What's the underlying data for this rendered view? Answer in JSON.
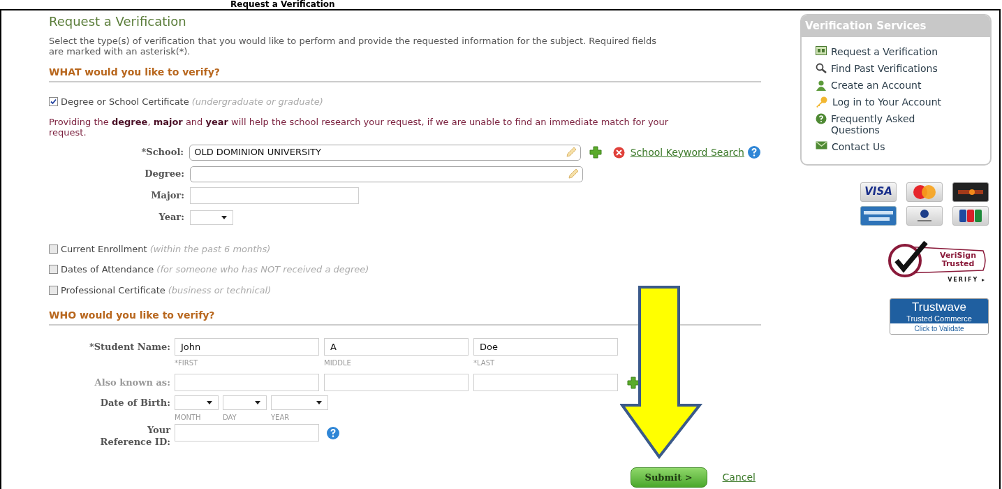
{
  "banner": "Request a Verification",
  "page_title": "Request a Verification",
  "intro": "Select the type(s) of verification that you would like to perform and provide the requested information for the subject. Required fields are marked with an asterisk(*).",
  "what_heading": "WHAT would you like to verify?",
  "degree_option": {
    "label": "Degree or School Certificate",
    "hint": "(undergraduate or graduate)",
    "checked": true
  },
  "advice": "Providing the **degree**, **major** and **year** will help the school research your request, if we are unable to find an immediate match for your request.",
  "school_fields": [
    {
      "kind": "lookup",
      "label": "*School:",
      "value": "OLD DOMINION UNIVERSITY",
      "add": true,
      "search_link": "School Keyword Search"
    },
    {
      "kind": "lookup",
      "label": "Degree:"
    },
    {
      "kind": "text",
      "label": "Major:"
    },
    {
      "kind": "select",
      "label": "Year:"
    }
  ],
  "other_options": [
    {
      "label": "Current Enrollment",
      "hint": "(within the past 6 months)",
      "checked": false
    },
    {
      "label": "Dates of Attendance",
      "hint": "(for someone who has NOT received a degree)",
      "checked": false
    },
    {
      "label": "Professional Certificate",
      "hint": "(business or technical)",
      "checked": false
    }
  ],
  "who_heading": "WHO would you like to verify?",
  "student_name": {
    "label": "*Student Name:",
    "parts": [
      {
        "value": "John",
        "caption": "*FIRST"
      },
      {
        "value": "A",
        "caption": "MIDDLE"
      },
      {
        "value": "Doe",
        "caption": "*LAST"
      }
    ]
  },
  "also_known_as": {
    "label": "Also known as:",
    "disabled": true
  },
  "date_of_birth": {
    "label": "Date of Birth:",
    "parts": [
      "MONTH",
      "DAY",
      "YEAR"
    ]
  },
  "reference_id": {
    "label": "Your Reference ID:"
  },
  "submit": "Submit >",
  "cancel": "Cancel",
  "sidebar": {
    "title": "Verification Services",
    "items": [
      {
        "kind": "form",
        "label": "Request a Verification"
      },
      {
        "kind": "search",
        "label": "Find Past Verifications"
      },
      {
        "kind": "person",
        "label": "Create an Account"
      },
      {
        "kind": "key",
        "label": "Log in to Your Account"
      },
      {
        "kind": "help",
        "label": "Frequently Asked Questions"
      },
      {
        "kind": "mail",
        "label": "Contact Us"
      }
    ]
  },
  "cards": [
    {
      "kind": "visa",
      "label": "VISA"
    },
    {
      "kind": "mastercard"
    },
    {
      "kind": "discover"
    },
    {
      "kind": "amex"
    },
    {
      "kind": "diners"
    },
    {
      "kind": "jcb"
    }
  ],
  "verisign": {
    "line1": "VeriSign",
    "line2": "Trusted",
    "verify": "VERIFY ▸"
  },
  "trustwave": {
    "name": "Trustwave",
    "line2": "Trusted Commerce",
    "line3": "Click to Validate"
  }
}
